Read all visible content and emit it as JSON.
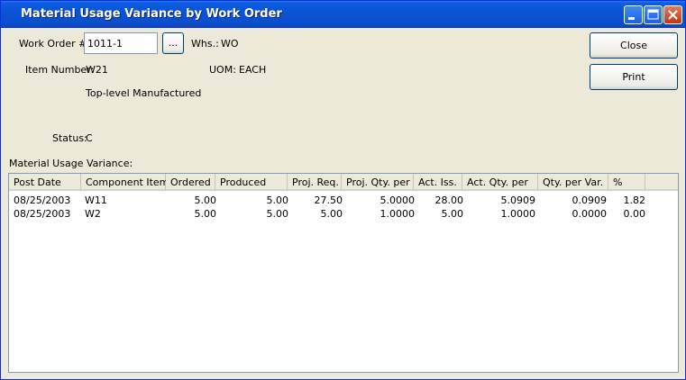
{
  "window": {
    "title": "Material Usage Variance by Work Order"
  },
  "form": {
    "work_order_label": "Work Order #:",
    "work_order_value": "1011-1",
    "lookup_label": "...",
    "whs_label": "Whs.:",
    "whs_value": "WO",
    "item_number_label": "Item Number:",
    "item_number_value": "W21",
    "uom_label": "UOM:",
    "uom_value": "EACH",
    "item_description": "Top-level Manufactured",
    "status_label": "Status:",
    "status_value": "C",
    "variance_section_label": "Material Usage Variance:"
  },
  "buttons": {
    "close": "Close",
    "print": "Print"
  },
  "table": {
    "columns": [
      "Post Date",
      "Component Item",
      "Ordered",
      "Produced",
      "Proj. Req.",
      "Proj. Qty. per",
      "Act. Iss.",
      "Act. Qty. per",
      "Qty. per Var.",
      "%"
    ],
    "rows": [
      [
        "08/25/2003",
        "W11",
        "5.00",
        "5.00",
        "27.50",
        "5.0000",
        "28.00",
        "5.0909",
        "0.0909",
        "1.82"
      ],
      [
        "08/25/2003",
        "W2",
        "5.00",
        "5.00",
        "5.00",
        "1.0000",
        "5.00",
        "1.0000",
        "0.0000",
        "0.00"
      ]
    ]
  }
}
